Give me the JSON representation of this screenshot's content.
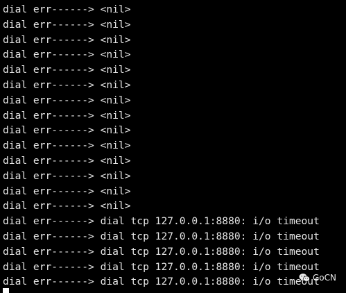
{
  "terminal": {
    "lines": [
      "dial err------> <nil>",
      "dial err------> <nil>",
      "dial err------> <nil>",
      "dial err------> <nil>",
      "dial err------> <nil>",
      "dial err------> <nil>",
      "dial err------> <nil>",
      "dial err------> <nil>",
      "dial err------> <nil>",
      "dial err------> <nil>",
      "dial err------> <nil>",
      "dial err------> <nil>",
      "dial err------> <nil>",
      "dial err------> <nil>",
      "dial err------> dial tcp 127.0.0.1:8880: i/o timeout",
      "dial err------> dial tcp 127.0.0.1:8880: i/o timeout",
      "dial err------> dial tcp 127.0.0.1:8880: i/o timeout",
      "dial err------> dial tcp 127.0.0.1:8880: i/o timeout",
      "dial err------> dial tcp 127.0.0.1:8880: i/o timeout"
    ],
    "colors": {
      "background": "#000000",
      "foreground": "#e6e6e6"
    }
  },
  "watermark": {
    "text": "GoCN",
    "icon": "wechat-icon"
  }
}
